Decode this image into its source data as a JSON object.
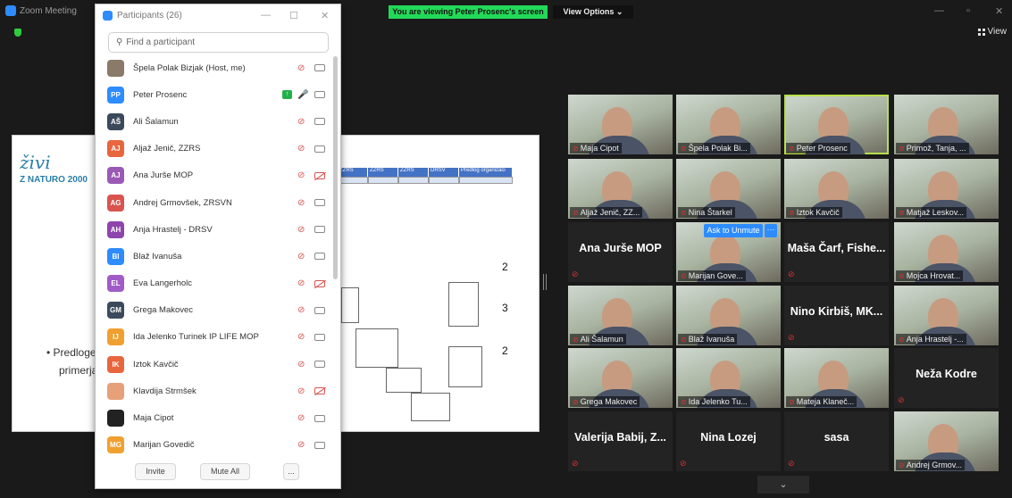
{
  "window": {
    "title": "Zoom Meeting",
    "banner": "You are viewing Peter Prosenc's screen",
    "view_options": "View Options ⌄",
    "view_label": "View",
    "minimize": "—",
    "maximize": "▫",
    "close": "✕"
  },
  "slide": {
    "logo_text": "živi",
    "logo_sub": "Z NATURO 2000",
    "table_headers": [
      "ZZRS",
      "ZZRS",
      "ZZRS",
      "DRSV",
      "Predlog organizaci"
    ],
    "numbers": [
      "2",
      "3",
      "2"
    ],
    "bullet_1": "• Predloge",
    "bullet_2": "primerjal"
  },
  "participants_panel": {
    "title": "Participants (26)",
    "minimize": "—",
    "maximize": "☐",
    "close": "✕",
    "search_placeholder": "Find a participant",
    "invite": "Invite",
    "mute_all": "Mute All",
    "more": "...",
    "items": [
      {
        "initials": "",
        "name": "Špela Polak Bizjak (Host, me)",
        "color": "#8a7a6a",
        "mic": "muted",
        "cam": "on"
      },
      {
        "initials": "PP",
        "name": "Peter Prosenc",
        "color": "#2d8cff",
        "mic": "on",
        "cam": "on",
        "sharing": true
      },
      {
        "initials": "AŠ",
        "name": "Ali Šalamun",
        "color": "#3b4a5a",
        "mic": "muted",
        "cam": "on"
      },
      {
        "initials": "AJ",
        "name": "Aljaž Jenič, ZZRS",
        "color": "#e8663d",
        "mic": "muted",
        "cam": "on"
      },
      {
        "initials": "AJ",
        "name": "Ana Jurše MOP",
        "color": "#9b59b6",
        "mic": "muted",
        "cam": "off"
      },
      {
        "initials": "AG",
        "name": "Andrej Grmovšek, ZRSVN",
        "color": "#d9534f",
        "mic": "muted",
        "cam": "on"
      },
      {
        "initials": "AH",
        "name": "Anja Hrastelj - DRSV",
        "color": "#8e44ad",
        "mic": "muted",
        "cam": "on"
      },
      {
        "initials": "BI",
        "name": "Blaž Ivanuša",
        "color": "#2d8cff",
        "mic": "muted",
        "cam": "on"
      },
      {
        "initials": "EL",
        "name": "Eva Langerholc",
        "color": "#a05bc6",
        "mic": "muted",
        "cam": "off"
      },
      {
        "initials": "GM",
        "name": "Grega Makovec",
        "color": "#3b4a5a",
        "mic": "muted",
        "cam": "on"
      },
      {
        "initials": "IJ",
        "name": "Ida Jelenko Turinek IP LIFE MOP",
        "color": "#f0a030",
        "mic": "muted",
        "cam": "on"
      },
      {
        "initials": "IK",
        "name": "Iztok Kavčič",
        "color": "#e8663d",
        "mic": "muted",
        "cam": "on"
      },
      {
        "initials": "",
        "name": "Klavdija Strmšek",
        "color": "#e6a07a",
        "mic": "muted",
        "cam": "off"
      },
      {
        "initials": "",
        "name": "Maja Cipot",
        "color": "#222222",
        "mic": "muted",
        "cam": "on"
      },
      {
        "initials": "MG",
        "name": "Marijan Govedič",
        "color": "#f0a030",
        "mic": "muted",
        "cam": "on"
      }
    ]
  },
  "video_grid": {
    "ask_to_unmute": "Ask to Unmute",
    "ask_more": "···",
    "chevron": "⌄",
    "tiles": [
      {
        "label": "Maja Cipot",
        "type": "photo"
      },
      {
        "label": "Špela Polak Bi...",
        "type": "photo"
      },
      {
        "label": "Peter Prosenc",
        "type": "photo",
        "active": true
      },
      {
        "label": "Primož, Tanja, ...",
        "type": "photo"
      },
      {
        "label": "Aljaž Jenič, ZZ...",
        "type": "photo"
      },
      {
        "label": "Nina Štarkel",
        "type": "photo"
      },
      {
        "label": "Iztok Kavčič",
        "type": "photo"
      },
      {
        "label": "Matjaž Leskov...",
        "type": "photo"
      },
      {
        "label": "Ana Jurše MOP",
        "type": "name"
      },
      {
        "label": "Marijan Gove...",
        "type": "photo"
      },
      {
        "label": "Maša Čarf, Fishe...",
        "type": "name"
      },
      {
        "label": "Mojca Hrovat...",
        "type": "photo"
      },
      {
        "label": "Ali Šalamun",
        "type": "photo"
      },
      {
        "label": "Blaž Ivanuša",
        "type": "photo"
      },
      {
        "label": "Nino Kirbiš, MK...",
        "type": "name"
      },
      {
        "label": "Anja Hrastelj -...",
        "type": "photo"
      },
      {
        "label": "Grega Makovec",
        "type": "photo"
      },
      {
        "label": "Ida Jelenko Tu...",
        "type": "photo"
      },
      {
        "label": "Mateja Klaneč...",
        "type": "photo"
      },
      {
        "label": "Neža Kodre",
        "type": "name"
      },
      {
        "label": "Valerija Babij, Z...",
        "type": "name"
      },
      {
        "label": "Nina Lozej",
        "type": "name"
      },
      {
        "label": "sasa",
        "type": "name"
      },
      {
        "label": "Andrej Grmov...",
        "type": "photo"
      }
    ]
  }
}
